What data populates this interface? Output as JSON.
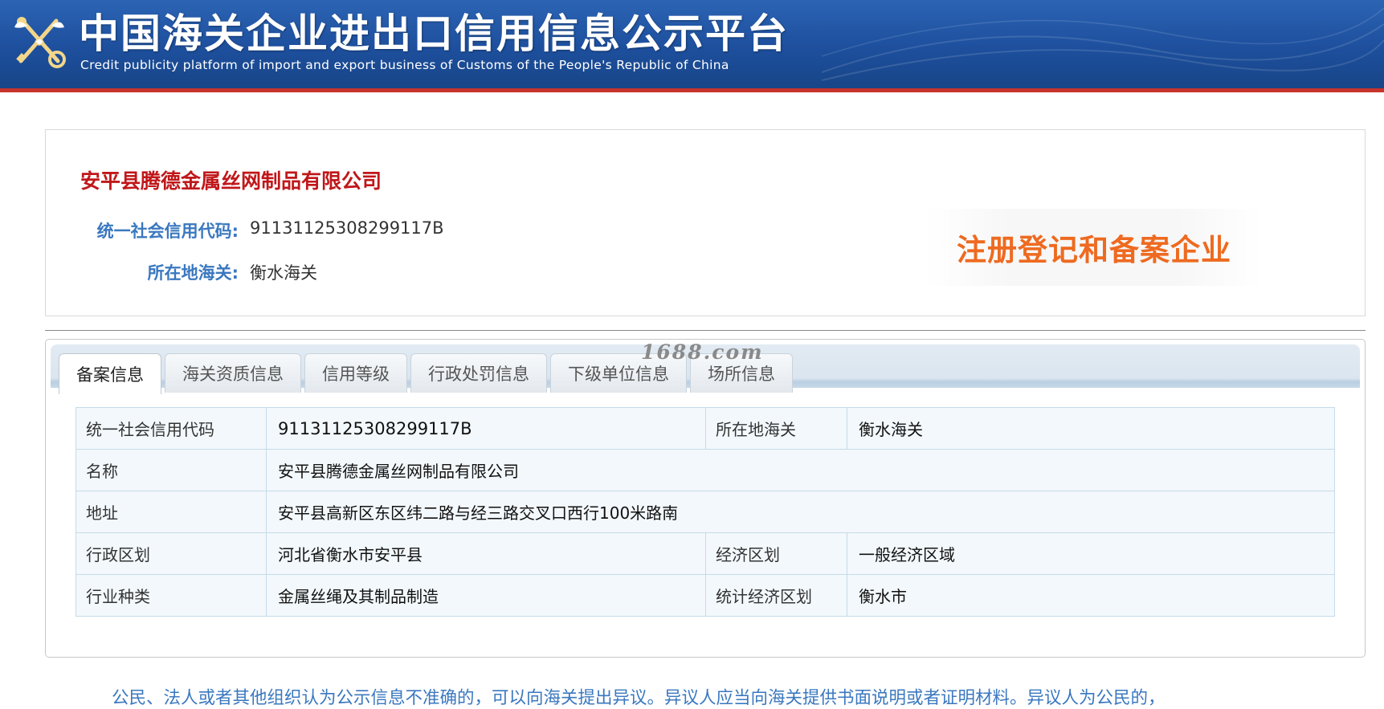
{
  "header": {
    "title": "中国海关企业进出口信用信息公示平台",
    "subtitle": "Credit publicity platform of import and export business of Customs of the People's Republic of China",
    "emblem_icon": "customs-emblem-icon",
    "colors": {
      "background": "#1d4f9d",
      "stripe": "#c8332c"
    }
  },
  "company": {
    "name": "安平县腾德金属丝网制品有限公司",
    "credit_code_label": "统一社会信用代码:",
    "credit_code": "91131125308299117B",
    "customs_label": "所在地海关:",
    "customs": "衡水海关",
    "status": "注册登记和备案企业",
    "colors": {
      "name": "#c0171a",
      "label": "#3a78bf",
      "status": "#ee6a20"
    }
  },
  "tabs": [
    {
      "label": "备案信息",
      "active": true
    },
    {
      "label": "海关资质信息",
      "active": false
    },
    {
      "label": "信用等级",
      "active": false
    },
    {
      "label": "行政处罚信息",
      "active": false
    },
    {
      "label": "下级单位信息",
      "active": false
    },
    {
      "label": "场所信息",
      "active": false
    }
  ],
  "watermark": "1688.com",
  "table": {
    "credit_code_label": "统一社会信用代码",
    "credit_code": "91131125308299117B",
    "customs_label": "所在地海关",
    "customs": "衡水海关",
    "name_label": "名称",
    "name": "安平县腾德金属丝网制品有限公司",
    "address_label": "地址",
    "address": "安平县高新区东区纬二路与经三路交叉口西行100米路南",
    "admin_region_label": "行政区划",
    "admin_region": "河北省衡水市安平县",
    "econ_region_label": "经济区划",
    "econ_region": "一般经济区域",
    "industry_label": "行业种类",
    "industry": "金属丝绳及其制品制造",
    "stat_region_label": "统计经济区划",
    "stat_region": "衡水市"
  },
  "notice": "公民、法人或者其他组织认为公示信息不准确的，可以向海关提出异议。异议人应当向海关提供书面说明或者证明材料。异议人为公民的，"
}
